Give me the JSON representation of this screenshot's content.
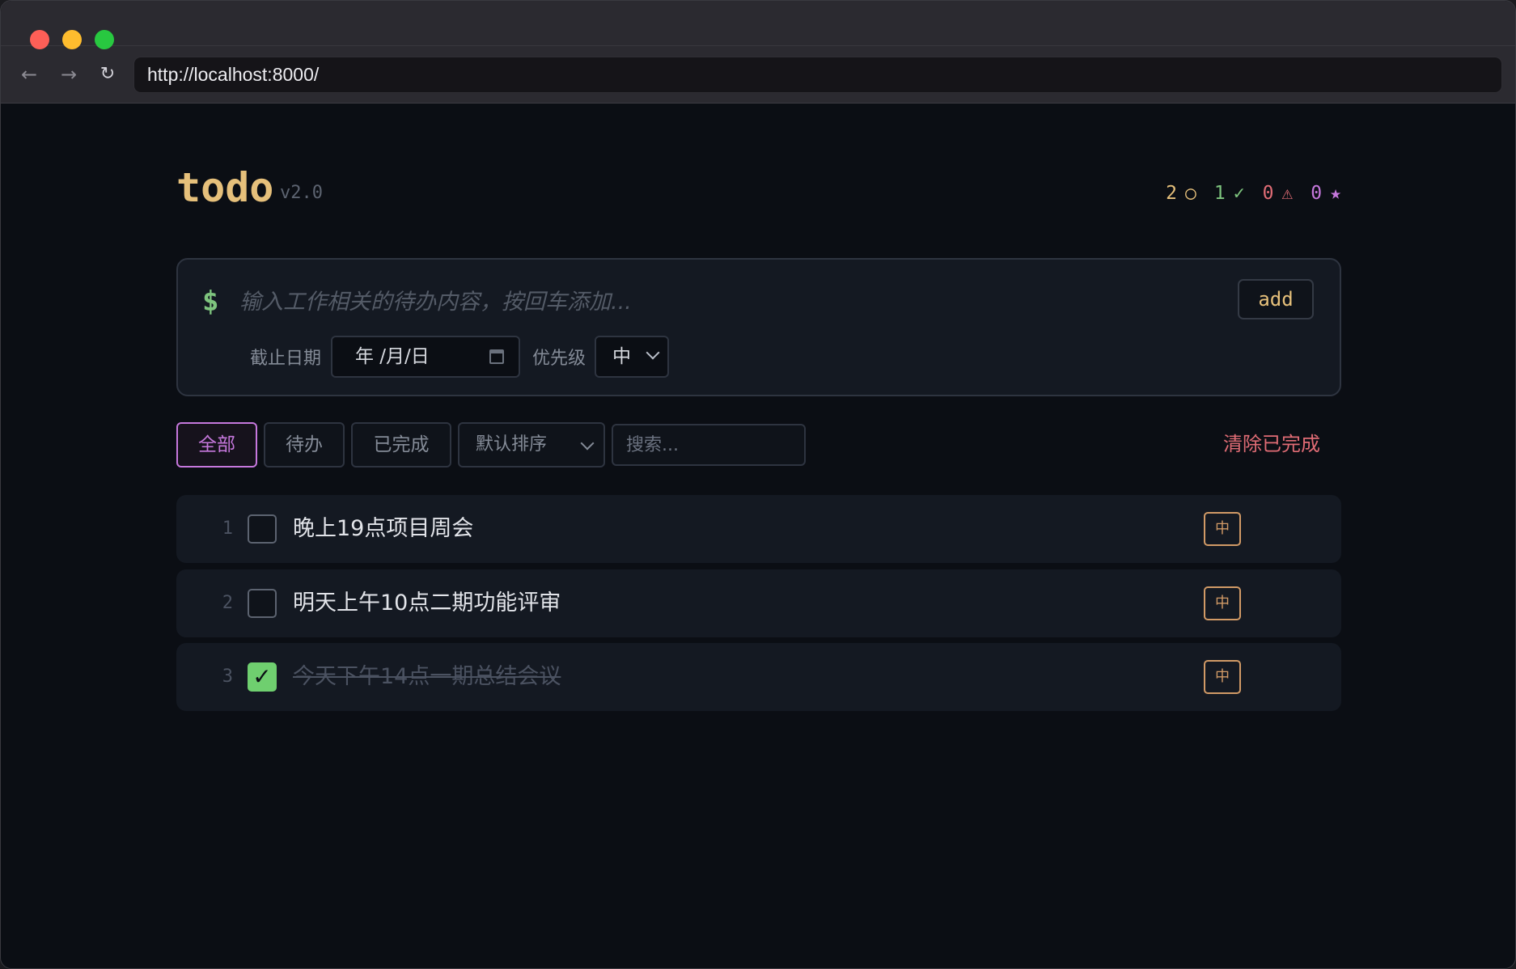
{
  "browser": {
    "url": "http://localhost:8000/",
    "back_icon": "←",
    "forward_icon": "→",
    "reload_icon": "↻"
  },
  "app": {
    "title": "todo",
    "version": "v2.0",
    "stats": [
      {
        "count": "2",
        "icon": "○",
        "color": "#e6c07b",
        "meaning": "pending"
      },
      {
        "count": "1",
        "icon": "✓",
        "color": "#7ec47e",
        "meaning": "completed"
      },
      {
        "count": "0",
        "icon": "⚠",
        "color": "#e06c75",
        "meaning": "overdue"
      },
      {
        "count": "0",
        "icon": "★",
        "color": "#c678dd",
        "meaning": "starred"
      }
    ]
  },
  "input": {
    "prompt": "$",
    "placeholder": "输入工作相关的待办内容，按回车添加...",
    "add_label": "add",
    "due_label": "截止日期",
    "date_value": "年 /月/日",
    "priority_label": "优先级",
    "priority_value": "中"
  },
  "filters": {
    "all": "全部",
    "pending": "待办",
    "done": "已完成",
    "active": "all",
    "sort_value": "默认排序",
    "search_placeholder": "搜索...",
    "clear_label": "清除已完成"
  },
  "todos": [
    {
      "num": "1",
      "text": "晚上19点项目周会",
      "done": false,
      "priority": "中"
    },
    {
      "num": "2",
      "text": "明天上午10点二期功能评审",
      "done": false,
      "priority": "中"
    },
    {
      "num": "3",
      "text": "今天下午14点一期总结会议",
      "done": true,
      "priority": "中"
    }
  ],
  "colors": {
    "accent": "#c678dd",
    "title": "#e6c07b",
    "prompt": "#7ec47e",
    "danger": "#e06c75",
    "priority_medium": "#d19a66"
  }
}
